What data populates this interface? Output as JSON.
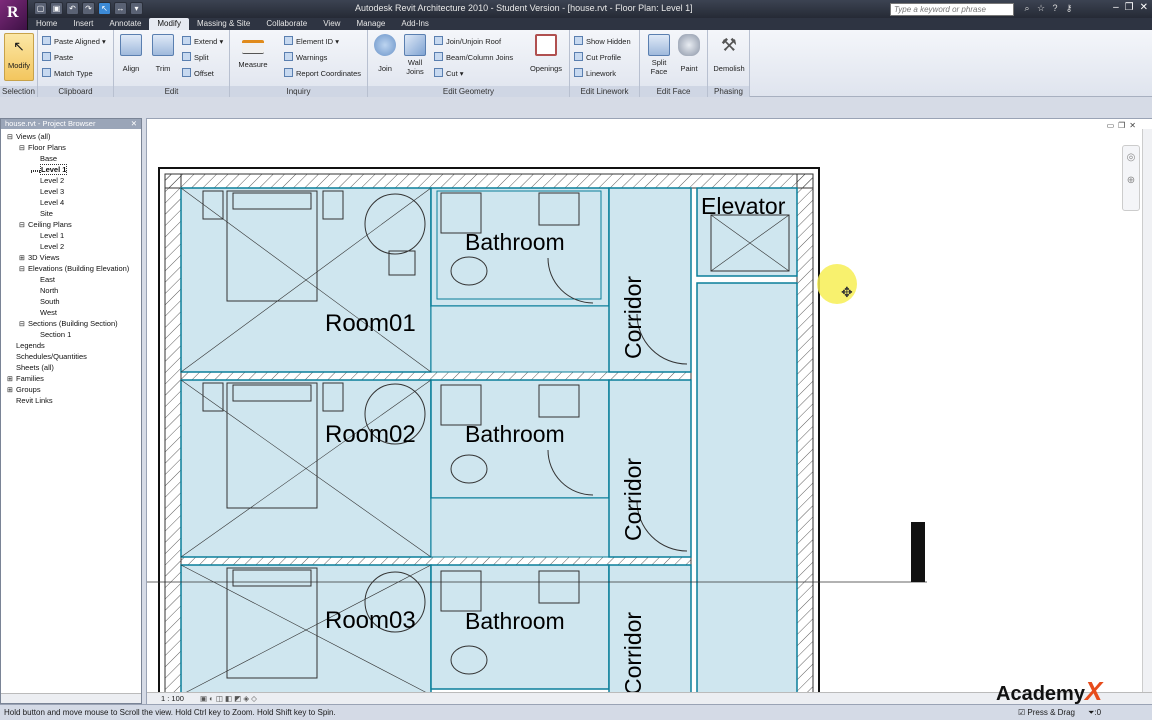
{
  "app": {
    "logo_letter": "R",
    "title": "Autodesk Revit Architecture 2010 - Student Version - [house.rvt - Floor Plan: Level 1]",
    "search_placeholder": "Type a keyword or phrase"
  },
  "tabs": [
    "Home",
    "Insert",
    "Annotate",
    "Modify",
    "Massing & Site",
    "Collaborate",
    "View",
    "Manage",
    "Add-Ins"
  ],
  "active_tab": "Modify",
  "ribbon": {
    "modify": "Modify",
    "paste_aligned": "Paste Aligned",
    "paste": "Paste",
    "match_type": "Match Type",
    "align": "Align",
    "trim": "Trim",
    "extend": "Extend",
    "split": "Split",
    "offset": "Offset",
    "measure": "Measure",
    "element_id": "Element ID",
    "warnings": "Warnings",
    "report_coordinates": "Report Coordinates",
    "join": "Join",
    "wall_joins_1": "Wall",
    "wall_joins_2": "Joins",
    "join_unjoin_roof": "Join/Unjoin Roof",
    "beam_column_joins": "Beam/Column Joins",
    "cut": "Cut",
    "openings": "Openings",
    "show_hidden": "Show Hidden",
    "cut_profile": "Cut Profile",
    "linework": "Linework",
    "split_face_1": "Split",
    "split_face_2": "Face",
    "paint": "Paint",
    "demolish": "Demolish",
    "panels": {
      "selection": "Selection",
      "clipboard": "Clipboard",
      "edit": "Edit",
      "inquiry": "Inquiry",
      "edit_geometry": "Edit Geometry",
      "edit_linework": "Edit Linework",
      "edit_face": "Edit Face",
      "phasing": "Phasing"
    }
  },
  "browser": {
    "header": "house.rvt - Project Browser",
    "items": [
      {
        "label": "Views (all)",
        "indent": 0,
        "sign": "-"
      },
      {
        "label": "Floor Plans",
        "indent": 1,
        "sign": "-"
      },
      {
        "label": "Base",
        "indent": 2,
        "sign": ""
      },
      {
        "label": "Level 1",
        "indent": 2,
        "sign": "",
        "selected": true
      },
      {
        "label": "Level 2",
        "indent": 2,
        "sign": ""
      },
      {
        "label": "Level 3",
        "indent": 2,
        "sign": ""
      },
      {
        "label": "Level 4",
        "indent": 2,
        "sign": ""
      },
      {
        "label": "Site",
        "indent": 2,
        "sign": ""
      },
      {
        "label": "Ceiling Plans",
        "indent": 1,
        "sign": "-"
      },
      {
        "label": "Level 1",
        "indent": 2,
        "sign": ""
      },
      {
        "label": "Level 2",
        "indent": 2,
        "sign": ""
      },
      {
        "label": "3D Views",
        "indent": 1,
        "sign": "+"
      },
      {
        "label": "Elevations (Building Elevation)",
        "indent": 1,
        "sign": "-"
      },
      {
        "label": "East",
        "indent": 2,
        "sign": ""
      },
      {
        "label": "North",
        "indent": 2,
        "sign": ""
      },
      {
        "label": "South",
        "indent": 2,
        "sign": ""
      },
      {
        "label": "West",
        "indent": 2,
        "sign": ""
      },
      {
        "label": "Sections (Building Section)",
        "indent": 1,
        "sign": "-"
      },
      {
        "label": "Section 1",
        "indent": 2,
        "sign": ""
      },
      {
        "label": "Legends",
        "indent": 0,
        "sign": ""
      },
      {
        "label": "Schedules/Quantities",
        "indent": 0,
        "sign": ""
      },
      {
        "label": "Sheets (all)",
        "indent": 0,
        "sign": ""
      },
      {
        "label": "Families",
        "indent": 0,
        "sign": "+"
      },
      {
        "label": "Groups",
        "indent": 0,
        "sign": "+"
      },
      {
        "label": "Revit Links",
        "indent": 0,
        "sign": ""
      }
    ]
  },
  "plan": {
    "rooms": [
      "Room01",
      "Room02",
      "Room03"
    ],
    "bathroom": "Bathroom",
    "corridor": "Corridor",
    "elevator": "Elevator"
  },
  "view": {
    "scale": "1 : 100"
  },
  "status": {
    "message": "Hold button and move mouse to Scroll the view. Hold Ctrl key to Zoom. Hold Shift key to Spin.",
    "press_drag": "Press & Drag",
    "filter": ":0"
  },
  "watermark": "Academy"
}
